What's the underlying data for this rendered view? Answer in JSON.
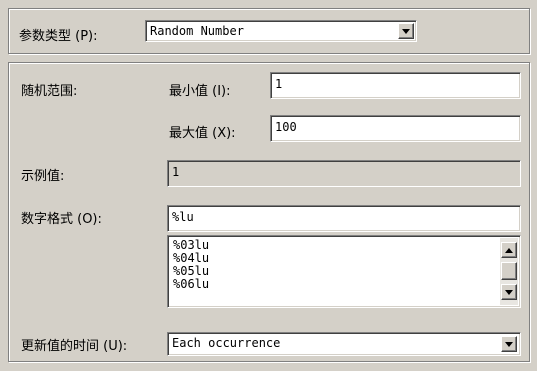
{
  "param_type": {
    "label": "参数类型 (P):",
    "value": "Random Number"
  },
  "range": {
    "label": "随机范围:",
    "min_label": "最小值 (I):",
    "min_value": "1",
    "max_label": "最大值 (X):",
    "max_value": "100"
  },
  "sample": {
    "label": "示例值:",
    "value": "1"
  },
  "number_format": {
    "label": "数字格式 (O):",
    "value": "%lu",
    "options": [
      "%03lu",
      "%04lu",
      "%05lu",
      "%06lu"
    ]
  },
  "update": {
    "label": "更新值的时间 (U):",
    "value": "Each occurrence"
  },
  "icons": {
    "dropdown": "chevron-down-icon",
    "scroll_up": "arrow-up-icon",
    "scroll_down": "arrow-down-icon"
  },
  "colors": {
    "face": "#d4d0c8",
    "field": "#ffffff",
    "shadow": "#808080"
  }
}
